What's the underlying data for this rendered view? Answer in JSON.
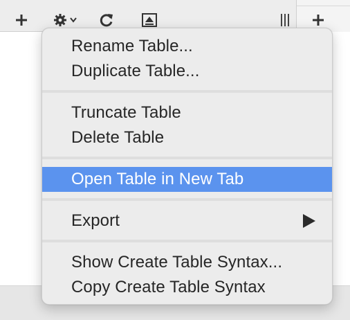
{
  "toolbar": {
    "buttons": [
      {
        "name": "add-table-button",
        "icon": "plus-icon"
      },
      {
        "name": "table-actions-button",
        "icon": "gear-icon"
      },
      {
        "name": "refresh-button",
        "icon": "refresh-icon"
      },
      {
        "name": "eject-button",
        "icon": "eject-icon"
      },
      {
        "name": "columns-button",
        "icon": "columns-icon"
      },
      {
        "name": "add-tab-button",
        "icon": "plus-icon"
      }
    ]
  },
  "menu": {
    "items": [
      {
        "label": "Rename Table..."
      },
      {
        "label": "Duplicate Table..."
      },
      {
        "label": "Truncate Table"
      },
      {
        "label": "Delete Table"
      },
      {
        "label": "Open Table in New Tab",
        "highlighted": true
      },
      {
        "label": "Export",
        "has_submenu": true
      },
      {
        "label": "Show Create Table Syntax..."
      },
      {
        "label": "Copy Create Table Syntax"
      }
    ]
  },
  "colors": {
    "highlight": "#5b93ee",
    "menu_background": "#ececec",
    "separator": "#dedede"
  }
}
